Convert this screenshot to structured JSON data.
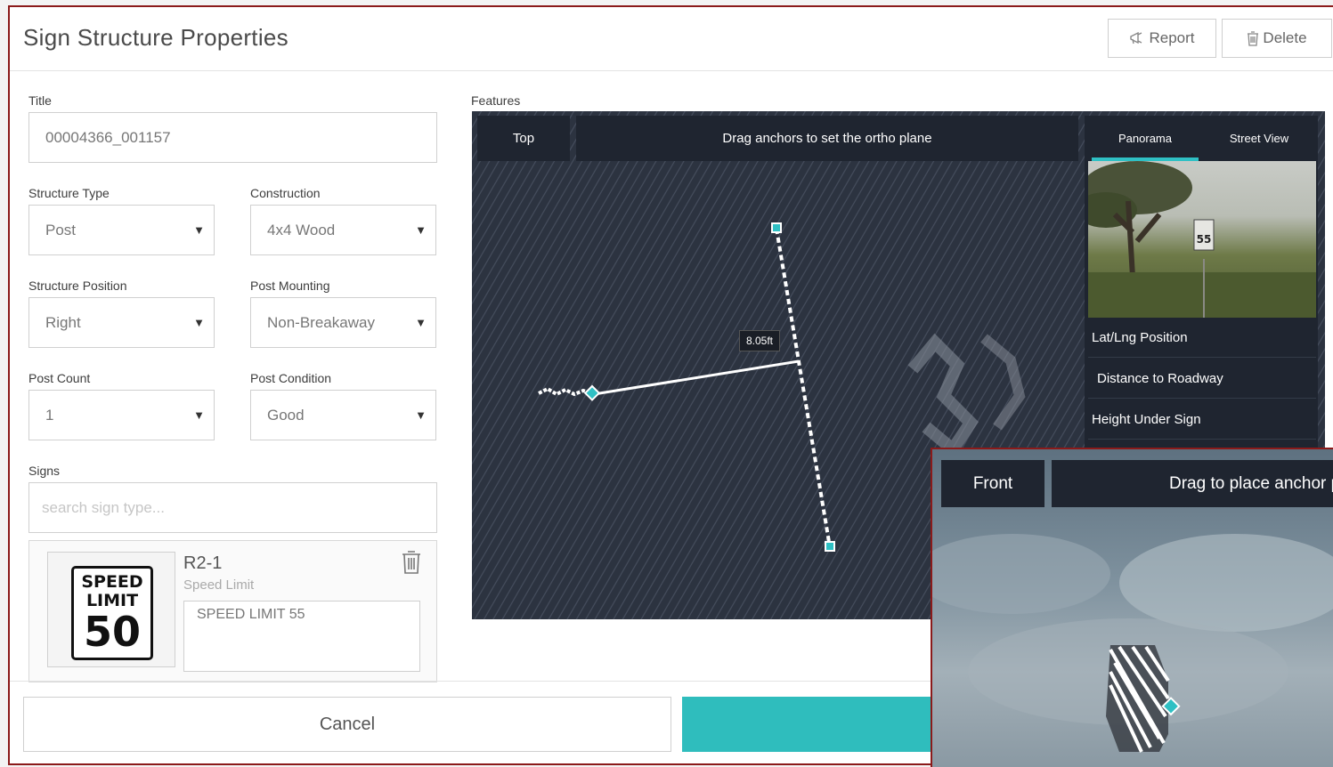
{
  "header": {
    "title": "Sign Structure Properties",
    "report_label": "Report",
    "delete_label": "Delete"
  },
  "form": {
    "title_label": "Title",
    "title_value": "00004366_001157",
    "structure_type_label": "Structure Type",
    "structure_type_value": "Post",
    "construction_label": "Construction",
    "construction_value": "4x4 Wood",
    "structure_position_label": "Structure Position",
    "structure_position_value": "Right",
    "post_mounting_label": "Post Mounting",
    "post_mounting_value": "Non-Breakaway",
    "post_count_label": "Post Count",
    "post_count_value": "1",
    "post_condition_label": "Post Condition",
    "post_condition_value": "Good",
    "signs_label": "Signs",
    "signs_placeholder": "search sign type..."
  },
  "sign_item": {
    "code": "R2-1",
    "name": "Speed Limit",
    "text_value": "SPEED LIMIT 55",
    "thumb_line1": "SPEED",
    "thumb_line2": "LIMIT",
    "thumb_number": "50"
  },
  "features": {
    "label": "Features",
    "top_tab": "Top",
    "instruction": "Drag anchors to set the ortho plane",
    "measurement": "8.05ft",
    "panel_tabs": [
      "Panorama",
      "Street View"
    ],
    "panel_rows": [
      "Lat/Lng Position",
      "Distance to Roadway",
      "Height Under Sign"
    ],
    "photo_sign": "55"
  },
  "footer": {
    "cancel_label": "Cancel",
    "save_label": ""
  },
  "front_view": {
    "tab": "Front",
    "instruction": "Drag to place anchor p"
  },
  "colors": {
    "accent": "#2fbdbd",
    "frame": "#8b1a1a",
    "viewer_bg": "#2c3340",
    "panel_bg": "#1f2530"
  }
}
